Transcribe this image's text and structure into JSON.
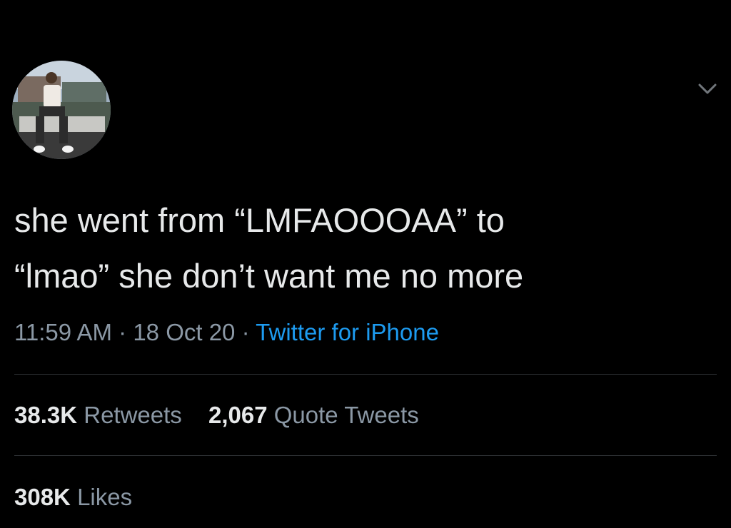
{
  "tweet": {
    "avatar_icon": "user-avatar-photo",
    "menu_icon": "chevron-down-icon",
    "text": "she went from “LMFAOOOAA” to\n“lmao” she don’t want me no more",
    "time": "11:59 AM",
    "date": "18 Oct 20",
    "separator": "·",
    "source": "Twitter for iPhone",
    "stats": {
      "retweets_count": "38.3K",
      "retweets_label": "Retweets",
      "quotes_count": "2,067",
      "quotes_label": "Quote Tweets",
      "likes_count": "308K",
      "likes_label": "Likes"
    }
  },
  "colors": {
    "background": "#000000",
    "text": "#e7e9ea",
    "secondary": "#8b98a5",
    "link": "#1d9bf0",
    "divider": "#2f3336"
  }
}
